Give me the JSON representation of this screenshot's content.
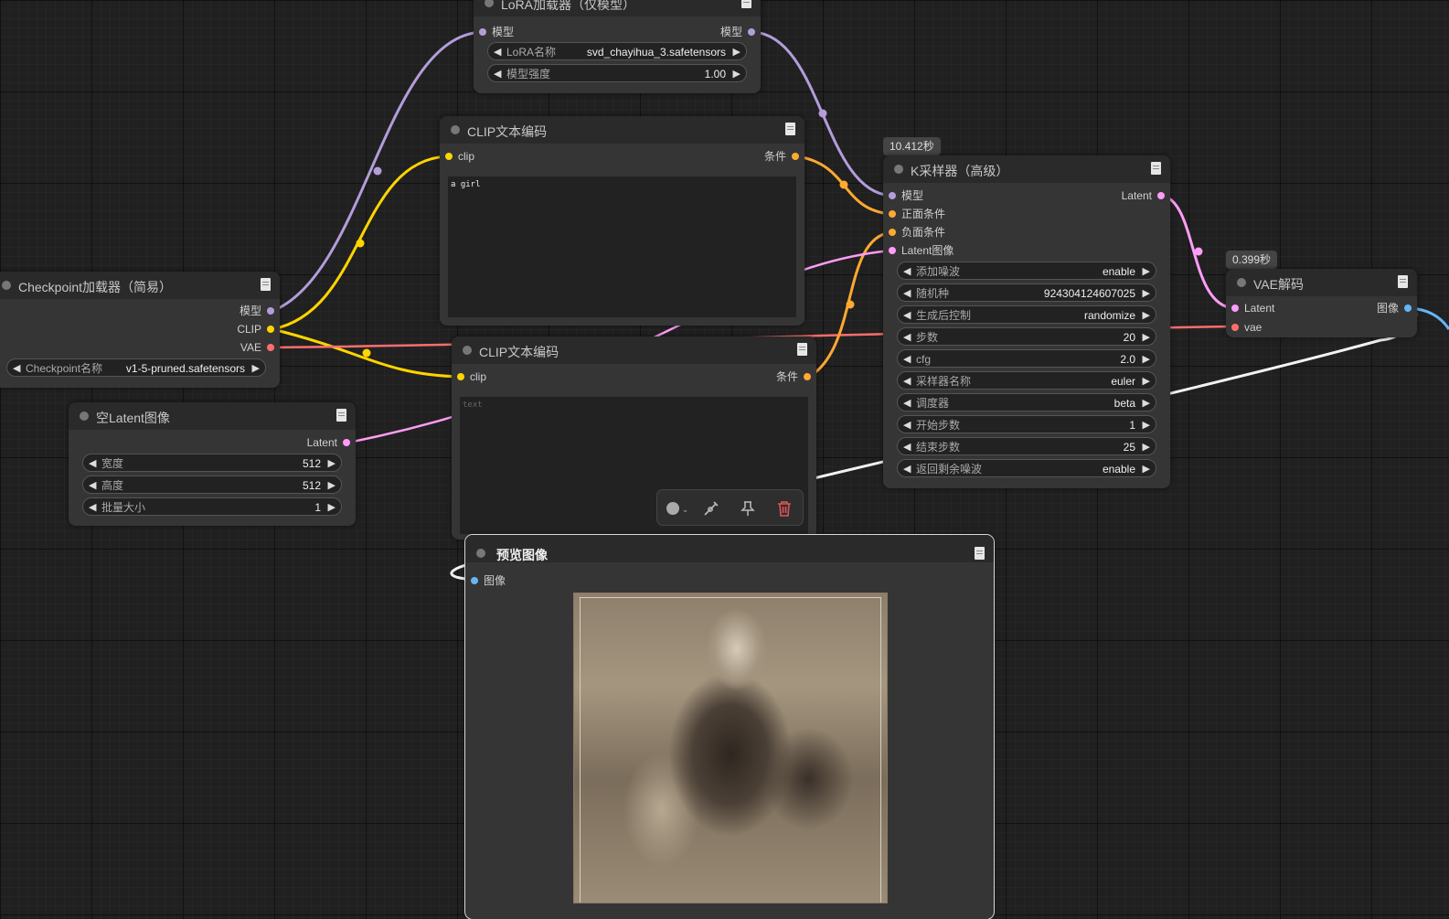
{
  "nodes": {
    "lora": {
      "title": "LoRA加载器（仅模型）",
      "input_model": "模型",
      "output_model": "模型",
      "widgets": [
        {
          "label": "LoRA名称",
          "value": "svd_chayihua_3.safetensors"
        },
        {
          "label": "模型强度",
          "value": "1.00"
        }
      ]
    },
    "clip1": {
      "title": "CLIP文本编码",
      "input_clip": "clip",
      "output": "条件",
      "text": "a girl"
    },
    "clip2": {
      "title": "CLIP文本编码",
      "input_clip": "clip",
      "output": "条件",
      "placeholder": "text"
    },
    "checkpoint": {
      "title": "Checkpoint加载器（简易）",
      "outputs": [
        "模型",
        "CLIP",
        "VAE"
      ],
      "widgets": [
        {
          "label": "Checkpoint名称",
          "value": "v1-5-pruned.safetensors"
        }
      ]
    },
    "latent": {
      "title": "空Latent图像",
      "output": "Latent",
      "widgets": [
        {
          "label": "宽度",
          "value": "512"
        },
        {
          "label": "高度",
          "value": "512"
        },
        {
          "label": "批量大小",
          "value": "1"
        }
      ]
    },
    "ksampler": {
      "badge": "10.412秒",
      "title": "K采样器（高级）",
      "inputs": [
        "模型",
        "正面条件",
        "负面条件",
        "Latent图像"
      ],
      "output": "Latent",
      "widgets": [
        {
          "label": "添加噪波",
          "value": "enable"
        },
        {
          "label": "随机种",
          "value": "924304124607025"
        },
        {
          "label": "生成后控制",
          "value": "randomize"
        },
        {
          "label": "步数",
          "value": "20"
        },
        {
          "label": "cfg",
          "value": "2.0"
        },
        {
          "label": "采样器名称",
          "value": "euler"
        },
        {
          "label": "调度器",
          "value": "beta"
        },
        {
          "label": "开始步数",
          "value": "1"
        },
        {
          "label": "结束步数",
          "value": "25"
        },
        {
          "label": "返回剩余噪波",
          "value": "enable"
        }
      ]
    },
    "vae": {
      "badge": "0.399秒",
      "title": "VAE解码",
      "inputs": [
        "Latent",
        "vae"
      ],
      "output": "图像"
    },
    "preview": {
      "title": "预览图像",
      "input": "图像"
    }
  },
  "colors": {
    "model": "#b39ddb",
    "clip": "#ffd500",
    "vae": "#ff6e6e",
    "latent": "#ff9cf9",
    "conditioning": "#ffa931",
    "image": "#64b5f6"
  },
  "toolbar": {
    "color_icon": "color-picker-icon",
    "bypass_icon": "bypass-icon",
    "pin_icon": "pin-icon",
    "delete_icon": "trash-icon"
  }
}
